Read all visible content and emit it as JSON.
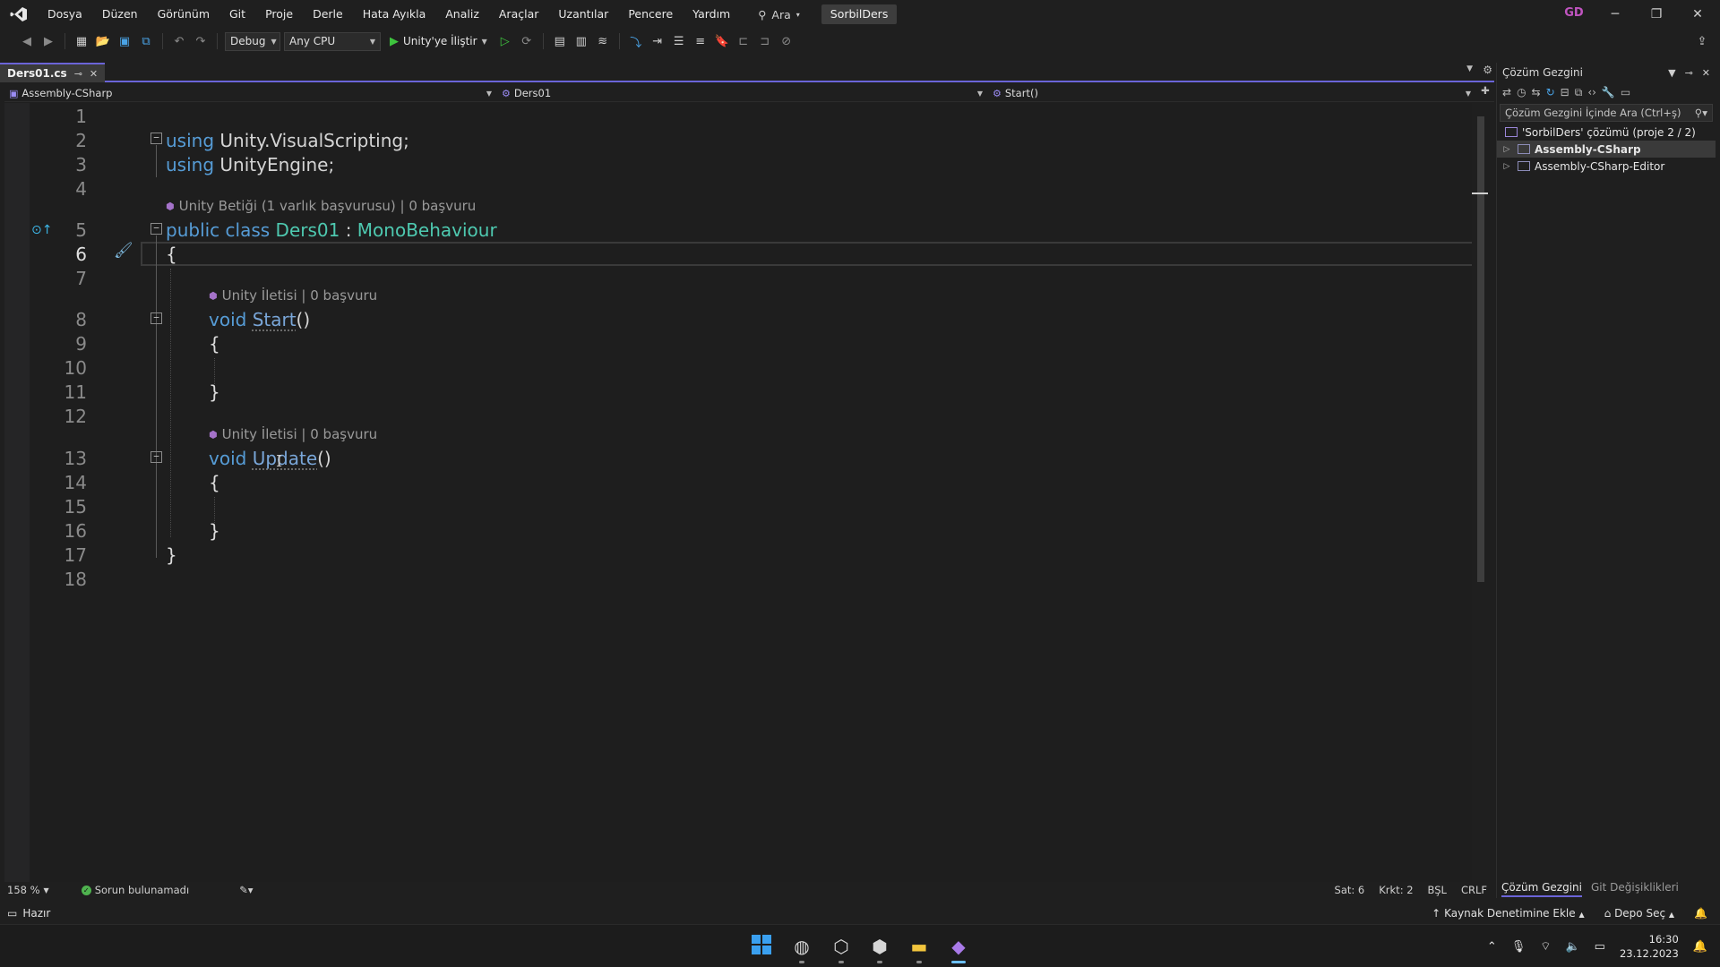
{
  "menubar": {
    "items": [
      "Dosya",
      "Düzen",
      "Görünüm",
      "Git",
      "Proje",
      "Derle",
      "Hata Ayıkla",
      "Analiz",
      "Araçlar",
      "Uzantılar",
      "Pencere",
      "Yardım"
    ],
    "search_label": "Ara",
    "solution_name": "SorbilDers",
    "account_initials": "GD"
  },
  "toolbar": {
    "config": "Debug",
    "platform": "Any CPU",
    "run_label": "Unity'ye İliştir"
  },
  "document_tab": {
    "title": "Ders01.cs"
  },
  "navbar": {
    "project": "Assembly-CSharp",
    "type": "Ders01",
    "member": "Start()"
  },
  "editor": {
    "line_numbers": [
      "1",
      "2",
      "3",
      "4",
      "5",
      "6",
      "7",
      "8",
      "9",
      "10",
      "11",
      "12",
      "13",
      "14",
      "15",
      "16",
      "17",
      "18"
    ],
    "current_line": "6",
    "code": {
      "l2_kw": "using",
      "l2_rest": " Unity.VisualScripting;",
      "l3_kw": "using",
      "l3_rest": " UnityEngine;",
      "l5_kw": "public class",
      "l5_name": "Ders01",
      "l5_colon": " : ",
      "l5_base": "MonoBehaviour",
      "l6": "{",
      "l8_kw": "void",
      "l8_name": "Start",
      "l8_parens": "()",
      "l9": "{",
      "l11": "}",
      "l13_kw": "void",
      "l13_name": "Update",
      "l13_parens": "()",
      "l14": "{",
      "l16": "}",
      "l17": "}"
    },
    "codelens": {
      "class": "Unity Betiği (1 varlık başvurusu) | 0 başvuru",
      "start": "Unity İletisi | 0 başvuru",
      "update": "Unity İletisi | 0 başvuru"
    }
  },
  "editor_status": {
    "zoom": "158 %",
    "issues": "Sorun bulunamadı",
    "line": "Sat: 6",
    "col": "Krkt: 2",
    "whitespace": "BŞL",
    "eol": "CRLF"
  },
  "solution_explorer": {
    "title": "Çözüm Gezgini",
    "search_placeholder": "Çözüm Gezgini İçinde Ara (Ctrl+ş)",
    "solution_row": "'SorbilDers' çözümü (proje 2 / 2)",
    "projects": [
      "Assembly-CSharp",
      "Assembly-CSharp-Editor"
    ],
    "tabs": [
      "Çözüm Gezgini",
      "Git Değişiklikleri"
    ]
  },
  "statusbar": {
    "ready": "Hazır",
    "source_control": "Kaynak Denetimine Ekle",
    "repo": "Depo Seç"
  },
  "taskbar": {
    "time": "16:30",
    "date": "23.12.2023",
    "apps": [
      "start-icon",
      "chrome-icon",
      "unity-hub-icon",
      "unity-icon",
      "file-explorer-icon",
      "visual-studio-icon"
    ]
  },
  "colors": {
    "accent": "#6b64d8",
    "keyword": "#569cd6",
    "type": "#4ec9b0",
    "ok": "#4fb34f"
  }
}
